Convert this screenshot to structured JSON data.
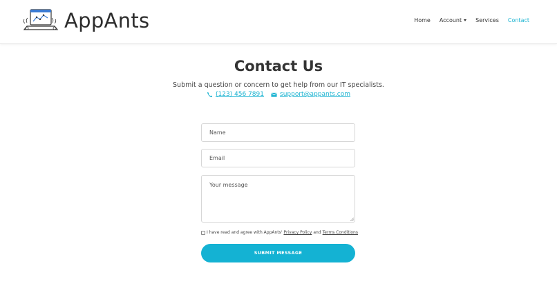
{
  "brand": {
    "name": "AppAnts",
    "logo_icon": "laptop-chart-icon"
  },
  "nav": {
    "items": [
      {
        "label": "Home",
        "active": false
      },
      {
        "label": "Account",
        "active": false,
        "dropdown": true
      },
      {
        "label": "Services",
        "active": false
      },
      {
        "label": "Contact",
        "active": true
      }
    ]
  },
  "page": {
    "title": "Contact Us",
    "subtitle": "Submit a question or concern to get help from our IT specialists.",
    "phone": "(123) 456 7891",
    "email": "support@appants.com",
    "phone_icon": "phone-icon",
    "email_icon": "envelope-icon"
  },
  "form": {
    "name_placeholder": "Name",
    "email_placeholder": "Email",
    "message_placeholder": "Your message",
    "agree_prefix": "I have read and agree with AppAnts'",
    "privacy_label": "Privacy Policy",
    "and_label": "and",
    "terms_label": "Terms Conditions",
    "submit_label": "SUBMIT MESSAGE"
  },
  "colors": {
    "accent": "#14b2d3",
    "text": "#333333",
    "border": "#d6d6d6"
  }
}
